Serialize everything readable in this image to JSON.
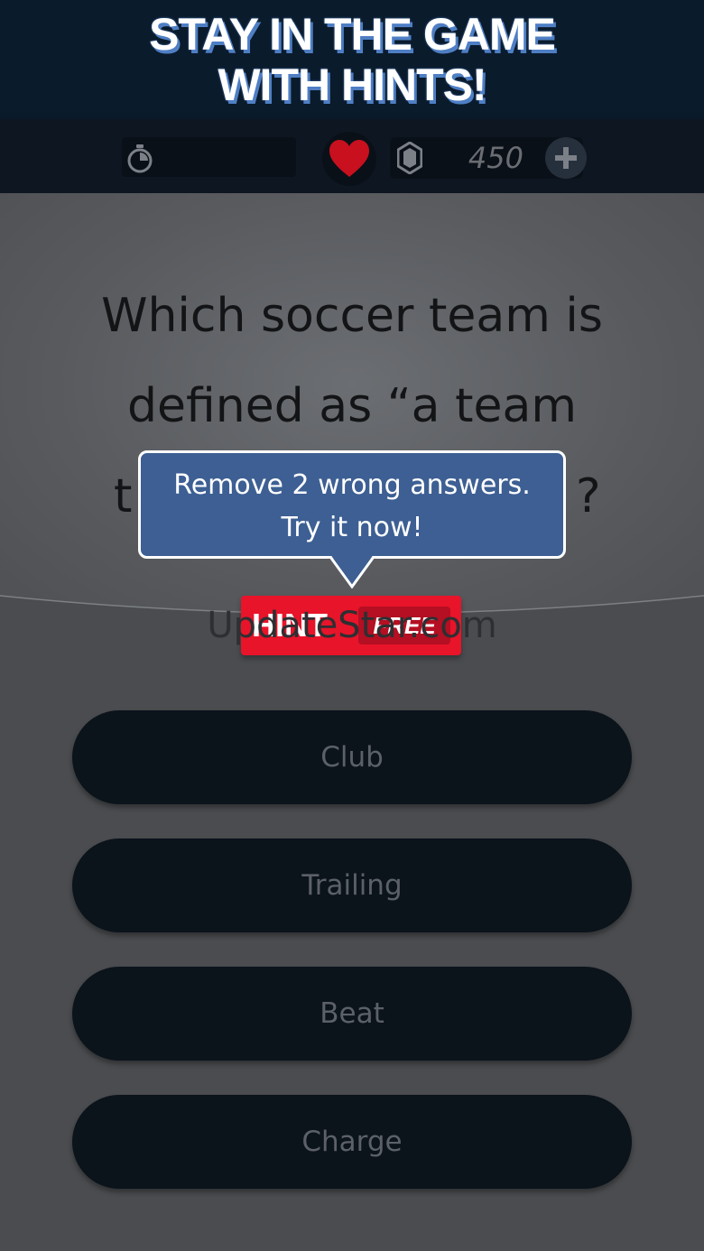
{
  "promo": {
    "line1": "STAY IN THE GAME",
    "line2": "WITH HINTS!"
  },
  "status_bar": {
    "timer_icon": "stopwatch-icon",
    "lives_icon": "heart-icon",
    "gem_icon": "gem-icon",
    "gem_count": "450",
    "add_icon": "plus-icon"
  },
  "question": {
    "line1": "Which soccer team is",
    "line2": "defined as “a team",
    "line3_start": "t",
    "line3_end": "?"
  },
  "tooltip": {
    "line1": "Remove 2 wrong answers.",
    "line2": "Try it now!"
  },
  "hint_button": {
    "label": "HINT",
    "badge": "FREE"
  },
  "watermark": "UpdateStar.com",
  "answers": [
    {
      "label": "Club"
    },
    {
      "label": "Trailing"
    },
    {
      "label": "Beat"
    },
    {
      "label": "Charge"
    }
  ],
  "colors": {
    "promo_bg": "#0a1b2c",
    "hint_red": "#e8142a",
    "tooltip_blue": "#3d5f93",
    "answer_bg": "#0b131b",
    "heart_red": "#d31220"
  }
}
